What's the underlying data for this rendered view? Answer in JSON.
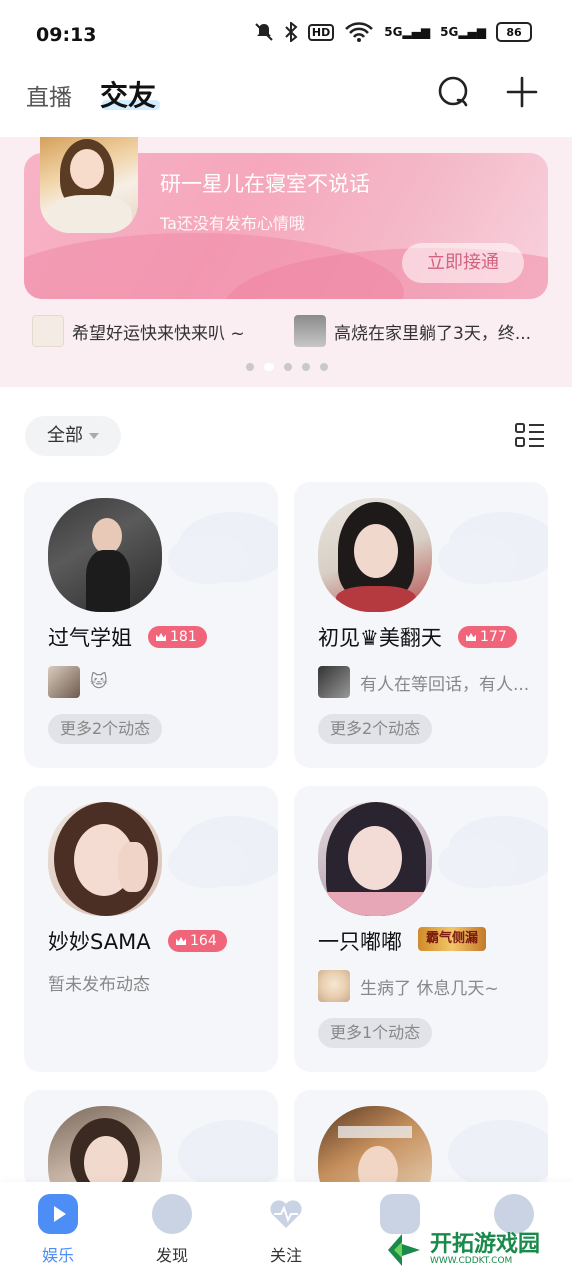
{
  "status_bar": {
    "time": "09:13",
    "battery": "86",
    "signal_1": "5G",
    "signal_2": "5G",
    "hd": "HD"
  },
  "top_nav": {
    "tab_live": "直播",
    "tab_friends": "交友",
    "search_icon": "search-icon",
    "add_icon": "plus-icon"
  },
  "banner": {
    "title": "研一星儿在寝室不说话",
    "subtitle": "Ta还没有发布心情哦",
    "button": "立即接通",
    "ticker": [
      "希望好运快来快来叭 ~",
      "高烧在家里躺了3天，终..."
    ],
    "page_count": 5,
    "active_page": 2
  },
  "filter": {
    "label": "全部",
    "view_toggle_icon": "list-grid-icon"
  },
  "cards": [
    {
      "name": "过气学姐",
      "level": "181",
      "status": "🐱",
      "more": "更多2个动态"
    },
    {
      "name": "初见♛美翻天",
      "level": "177",
      "status": "有人在等回话，有人...",
      "more": "更多2个动态"
    },
    {
      "name": "妙妙SAMA",
      "level": "164",
      "status": "暂未发布动态",
      "more": ""
    },
    {
      "name": "一只嘟嘟",
      "title_badge": "霸气侧漏",
      "status": "生病了 休息几天~",
      "more": "更多1个动态"
    }
  ],
  "bottom_nav": [
    {
      "label": "娱乐",
      "active": true
    },
    {
      "label": "发现",
      "active": false
    },
    {
      "label": "关注",
      "active": false
    },
    {
      "label": "",
      "active": false
    },
    {
      "label": "",
      "active": false
    }
  ],
  "watermark": {
    "text": "开拓游戏园",
    "sub": "WWW.CDDKT.COM"
  },
  "colors": {
    "accent": "#4c8df6",
    "badge": "#f1657a",
    "banner": "#f6a7bc",
    "card_bg": "#f5f6fa"
  }
}
